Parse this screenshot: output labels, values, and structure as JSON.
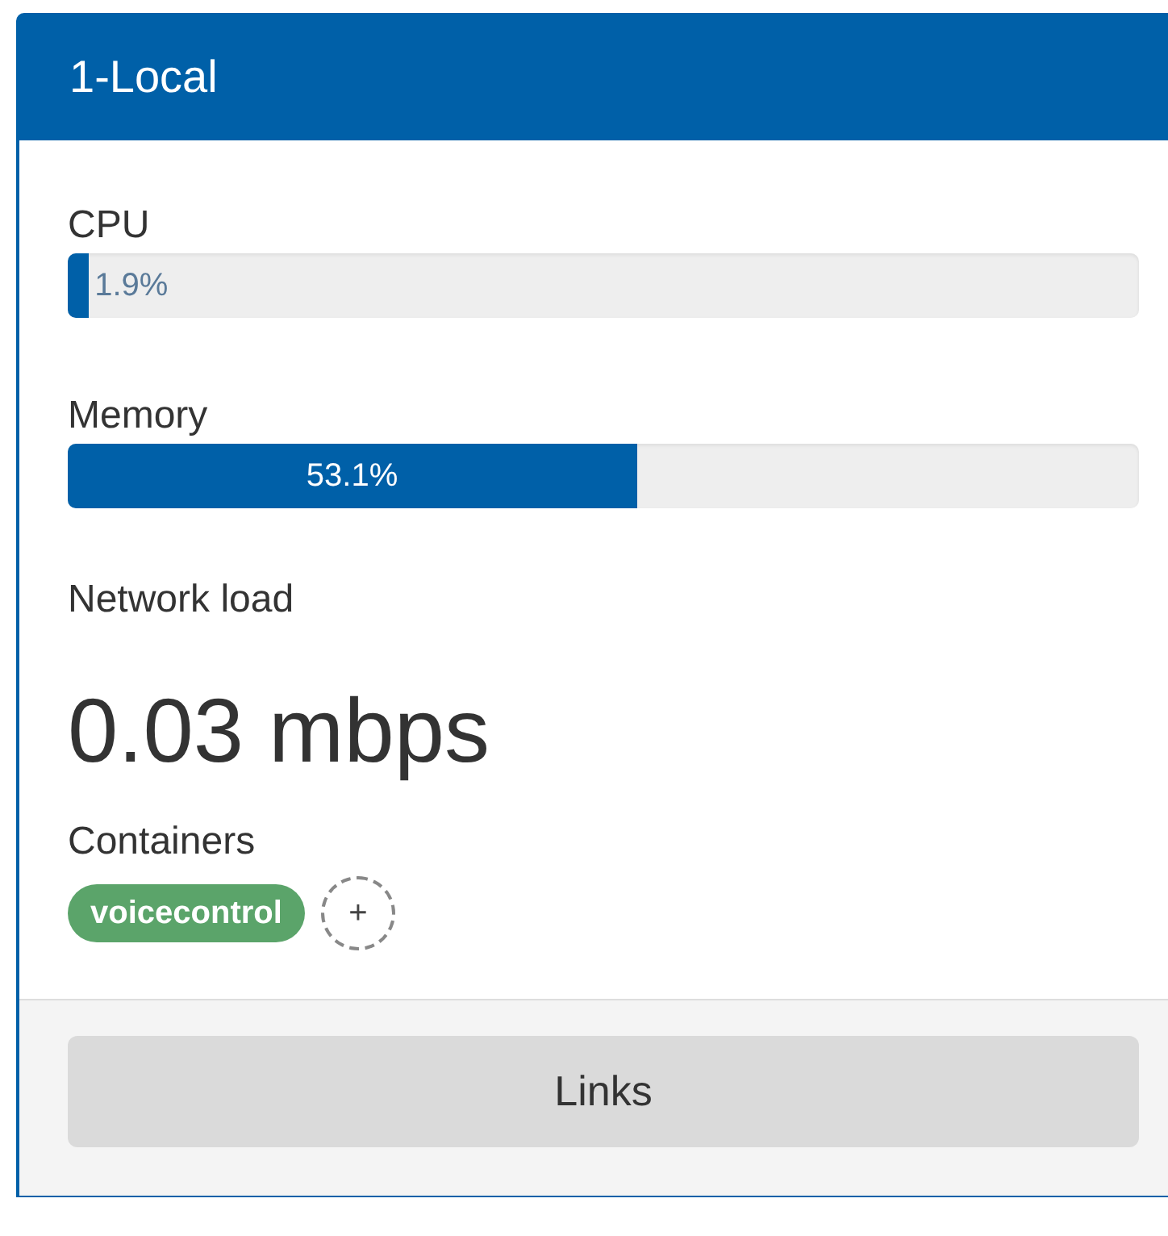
{
  "panel": {
    "title": "1-Local"
  },
  "meters": [
    {
      "label": "CPU",
      "level": 0.019,
      "reading": "1.9%"
    },
    {
      "label": "Memory",
      "level": 0.531,
      "reading": "53.1%"
    }
  ],
  "network": {
    "label": "Network load",
    "value": "0.03 mbps"
  },
  "containers": {
    "label": "Containers",
    "tags": [
      {
        "name": "voicecontrol",
        "color": "#5ba46a"
      }
    ],
    "add_button": "+"
  },
  "footer": {
    "button": "Links"
  }
}
